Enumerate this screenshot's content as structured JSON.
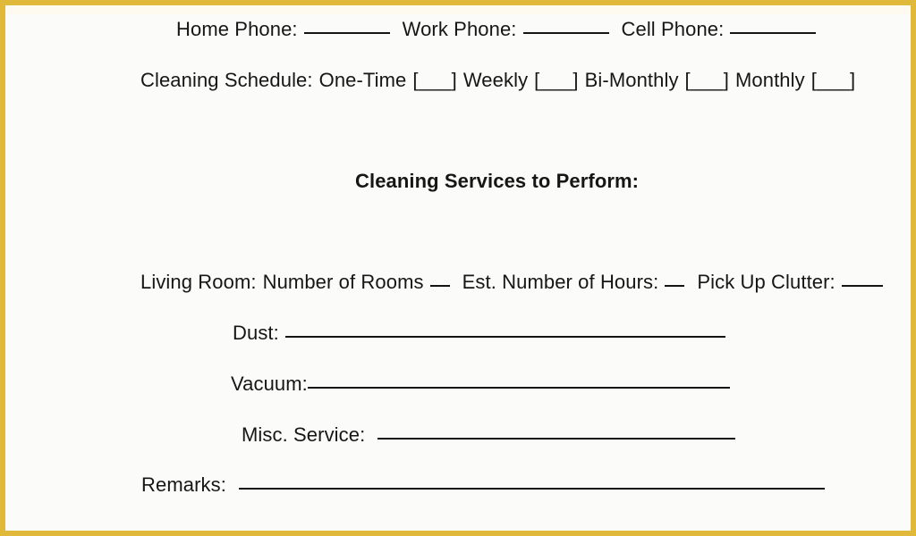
{
  "page": {
    "border_color": "#e0b93a",
    "background_color": "#fbfbfa",
    "text_color": "#161616"
  },
  "form": {
    "contact_line": {
      "home_phone_label": "Home Phone:",
      "work_phone_label": "Work Phone:",
      "cell_phone_label": "Cell Phone:"
    },
    "schedule_line": {
      "label": "Cleaning Schedule:",
      "options": [
        {
          "label": "One-Time",
          "bracket_open": "[",
          "blank": "___",
          "bracket_close": "]"
        },
        {
          "label": "Weekly",
          "bracket_open": "[",
          "blank": "___",
          "bracket_close": "]"
        },
        {
          "label": "Bi-Monthly",
          "bracket_open": "[",
          "blank": "___",
          "bracket_close": "]"
        },
        {
          "label": "Monthly",
          "bracket_open": "[",
          "blank": "___",
          "bracket_close": "]"
        }
      ]
    },
    "section_heading": "Cleaning Services to Perform:",
    "room_line": {
      "room_label": "Living Room:",
      "rooms_label": "Number of Rooms",
      "rooms_blank": "__",
      "hours_label": "Est. Number of Hours:",
      "hours_blank": "__",
      "clutter_label": "Pick Up Clutter:",
      "clutter_blank": "___"
    },
    "service_items": [
      {
        "label": "Dust:"
      },
      {
        "label": "Vacuum:"
      },
      {
        "label": "Misc. Service:"
      }
    ],
    "remarks_label": "Remarks:"
  },
  "watermark": {
    "text": ""
  }
}
